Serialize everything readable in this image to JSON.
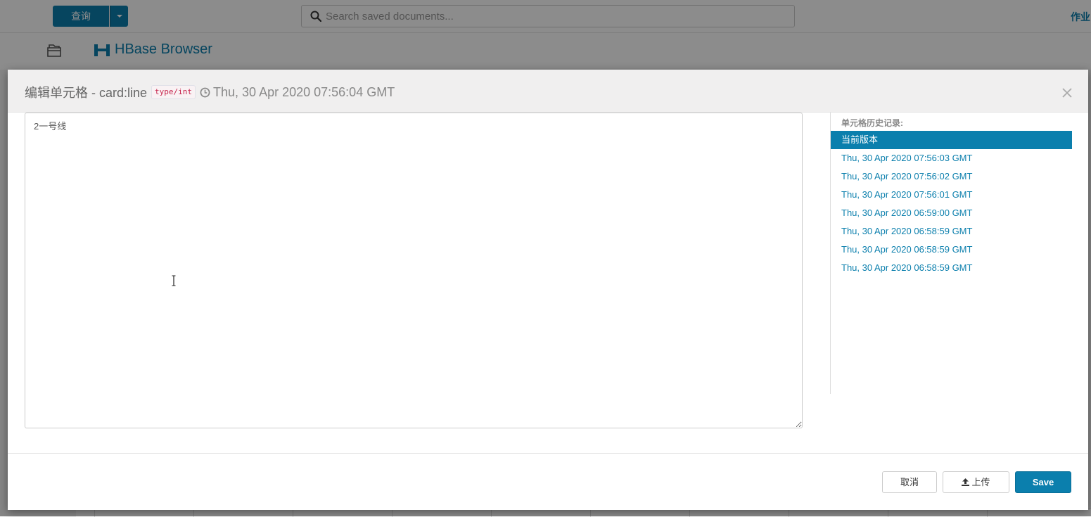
{
  "topbar": {
    "query_label": "查询",
    "search_placeholder": "Search saved documents...",
    "jobs_label": "作业"
  },
  "app": {
    "title": "HBase Browser"
  },
  "modal": {
    "title": "编辑单元格 - card:line",
    "type_tag": "type/int",
    "timestamp": "Thu, 30 Apr 2020 07:56:04 GMT",
    "cell_value": "2一号线",
    "history": {
      "title": "单元格历史记录:",
      "items": [
        "当前版本",
        "Thu, 30 Apr 2020 07:56:03 GMT",
        "Thu, 30 Apr 2020 07:56:02 GMT",
        "Thu, 30 Apr 2020 07:56:01 GMT",
        "Thu, 30 Apr 2020 06:59:00 GMT",
        "Thu, 30 Apr 2020 06:58:59 GMT",
        "Thu, 30 Apr 2020 06:58:59 GMT",
        "Thu, 30 Apr 2020 06:58:59 GMT"
      ]
    },
    "footer": {
      "cancel_label": "取消",
      "upload_label": "上传",
      "save_label": "Save"
    }
  },
  "colors": {
    "accent": "#0b7fad",
    "type_tag": "#c7254e"
  },
  "icons": [
    "search-icon",
    "folder-icon",
    "hbase-logo-icon",
    "clock-icon",
    "close-icon",
    "upload-icon",
    "text-cursor-icon"
  ]
}
